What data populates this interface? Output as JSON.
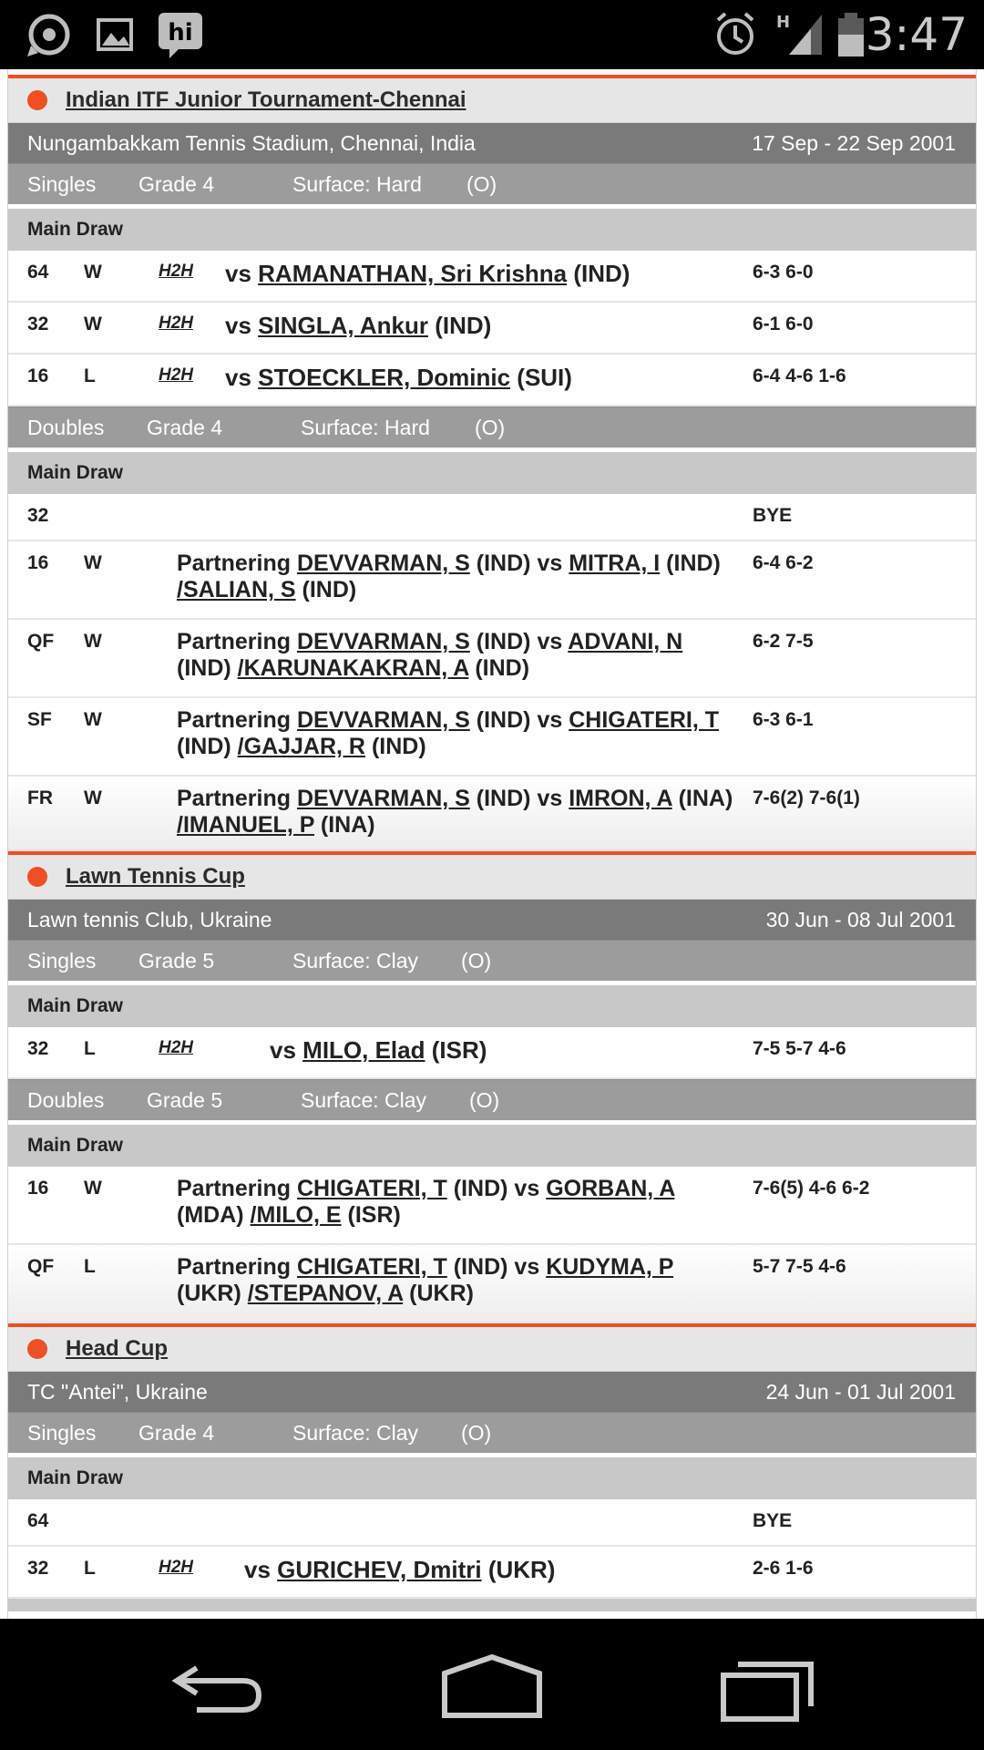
{
  "status_bar": {
    "time": "3:47",
    "network": "H"
  },
  "tournaments": [
    {
      "name": "Indian ITF Junior Tournament-Chennai",
      "venue": "Nungambakkam Tennis Stadium, Chennai, India",
      "dates": "17 Sep - 22 Sep 2001",
      "singles": {
        "type": "Singles",
        "grade": "Grade 4",
        "surface": "Surface: Hard",
        "io": "(O)",
        "draw": "Main Draw",
        "matches": [
          {
            "round": "64",
            "result": "W",
            "h2h": "H2H",
            "vs": "vs",
            "opponent": "RAMANATHAN, Sri Krishna",
            "nation": "(IND)",
            "score": "6-3 6-0"
          },
          {
            "round": "32",
            "result": "W",
            "h2h": "H2H",
            "vs": "vs",
            "opponent": "SINGLA, Ankur",
            "nation": "(IND)",
            "score": "6-1 6-0"
          },
          {
            "round": "16",
            "result": "L",
            "h2h": "H2H",
            "vs": "vs",
            "opponent": "STOECKLER, Dominic",
            "nation": "(SUI)",
            "score": "6-4 4-6 1-6"
          }
        ]
      },
      "doubles": {
        "type": "Doubles",
        "grade": "Grade 4",
        "surface": "Surface: Hard",
        "io": "(O)",
        "draw": "Main Draw",
        "matches": [
          {
            "round": "32",
            "result": "",
            "score": "BYE"
          },
          {
            "round": "16",
            "result": "W",
            "partner": "DEVVARMAN, S",
            "partner_nation": "(IND)",
            "opp1": "MITRA, I",
            "opp1_nation": "(IND)",
            "opp2": "/SALIAN, S",
            "opp2_nation": "(IND)",
            "score": "6-4 6-2"
          },
          {
            "round": "QF",
            "result": "W",
            "partner": "DEVVARMAN, S",
            "partner_nation": "(IND)",
            "opp1": "ADVANI, N",
            "opp1_nation": "(IND)",
            "opp2": "/KARUNAKAKRAN, A",
            "opp2_nation": "(IND)",
            "score": "6-2 7-5"
          },
          {
            "round": "SF",
            "result": "W",
            "partner": "DEVVARMAN, S",
            "partner_nation": "(IND)",
            "opp1": "CHIGATERI, T",
            "opp1_nation": "(IND)",
            "opp2": "/GAJJAR, R",
            "opp2_nation": "(IND)",
            "score": "6-3 6-1"
          },
          {
            "round": "FR",
            "result": "W",
            "partner": "DEVVARMAN, S",
            "partner_nation": "(IND)",
            "opp1": "IMRON, A",
            "opp1_nation": "(INA)",
            "opp2": "/IMANUEL, P",
            "opp2_nation": "(INA)",
            "score": "7-6(2) 7-6(1)"
          }
        ]
      }
    },
    {
      "name": "Lawn Tennis Cup",
      "venue": "Lawn tennis Club, Ukraine",
      "dates": "30 Jun - 08 Jul 2001",
      "singles": {
        "type": "Singles",
        "grade": "Grade 5",
        "surface": "Surface: Clay",
        "io": "(O)",
        "draw": "Main Draw",
        "matches": [
          {
            "round": "32",
            "result": "L",
            "h2h": "H2H",
            "vs": "vs",
            "opponent": "MILO, Elad",
            "nation": "(ISR)",
            "score": "7-5 5-7 4-6"
          }
        ]
      },
      "doubles": {
        "type": "Doubles",
        "grade": "Grade 5",
        "surface": "Surface: Clay",
        "io": "(O)",
        "draw": "Main Draw",
        "matches": [
          {
            "round": "16",
            "result": "W",
            "partner": "CHIGATERI, T",
            "partner_nation": "(IND)",
            "opp1": "GORBAN, A",
            "opp1_nation": "(MDA)",
            "opp2": "/MILO, E",
            "opp2_nation": "(ISR)",
            "score": "7-6(5) 4-6 6-2"
          },
          {
            "round": "QF",
            "result": "L",
            "partner": "CHIGATERI, T",
            "partner_nation": "(IND)",
            "opp1": "KUDYMA, P",
            "opp1_nation": "(UKR)",
            "opp2": "/STEPANOV, A",
            "opp2_nation": "(UKR)",
            "score": "5-7 7-5 4-6"
          }
        ]
      }
    },
    {
      "name": "Head Cup",
      "venue": "TC \"Antei\", Ukraine",
      "dates": "24 Jun - 01 Jul 2001",
      "singles": {
        "type": "Singles",
        "grade": "Grade 4",
        "surface": "Surface: Clay",
        "io": "(O)",
        "draw": "Main Draw",
        "matches": [
          {
            "round": "64",
            "result": "",
            "score": "BYE"
          },
          {
            "round": "32",
            "result": "L",
            "h2h": "H2H",
            "vs": "vs",
            "opponent": "GURICHEV, Dmitri",
            "nation": "(UKR)",
            "score": "2-6 1-6"
          }
        ]
      }
    }
  ],
  "labels": {
    "partnering": "Partnering",
    "vs": "vs"
  },
  "colors": {
    "accent": "#f04e23",
    "venue_bar": "#7a7a7a",
    "event_bar": "#9c9c9c",
    "draw_bar": "#c8c8c8"
  }
}
